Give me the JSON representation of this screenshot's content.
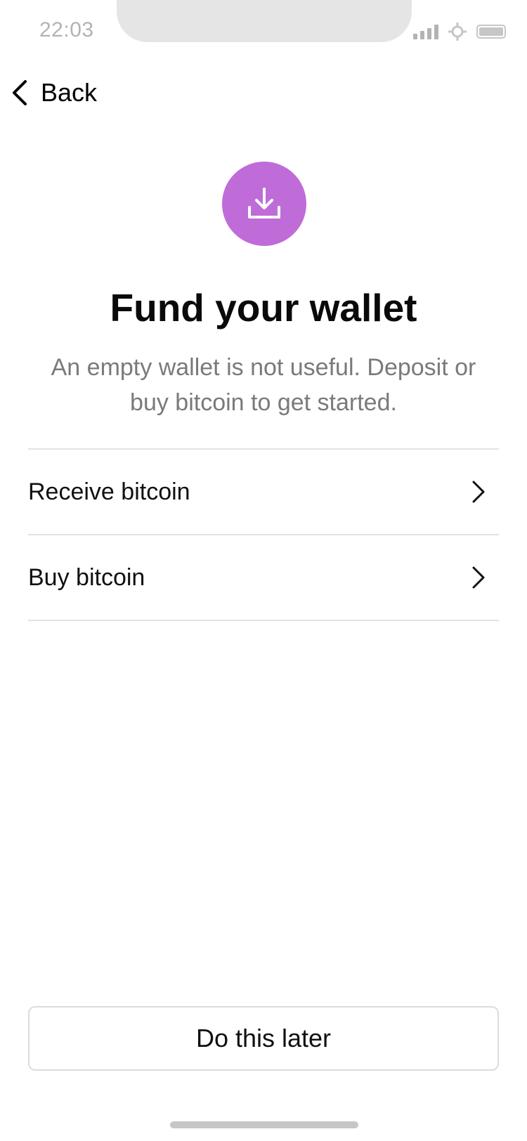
{
  "status_bar": {
    "time": "22:03",
    "icons": [
      "signal-icon",
      "location-icon",
      "battery-icon"
    ]
  },
  "nav": {
    "back_label": "Back",
    "back_icon": "chevron-left-icon"
  },
  "hero": {
    "icon": "download-icon",
    "icon_color": "#BF6CD9",
    "title": "Fund your wallet",
    "subtitle": "An empty wallet is not useful. Deposit or buy bitcoin to get started."
  },
  "options": [
    {
      "label": "Receive bitcoin",
      "icon": "chevron-right-icon"
    },
    {
      "label": "Buy bitcoin",
      "icon": "chevron-right-icon"
    }
  ],
  "footer": {
    "later_label": "Do this later"
  }
}
